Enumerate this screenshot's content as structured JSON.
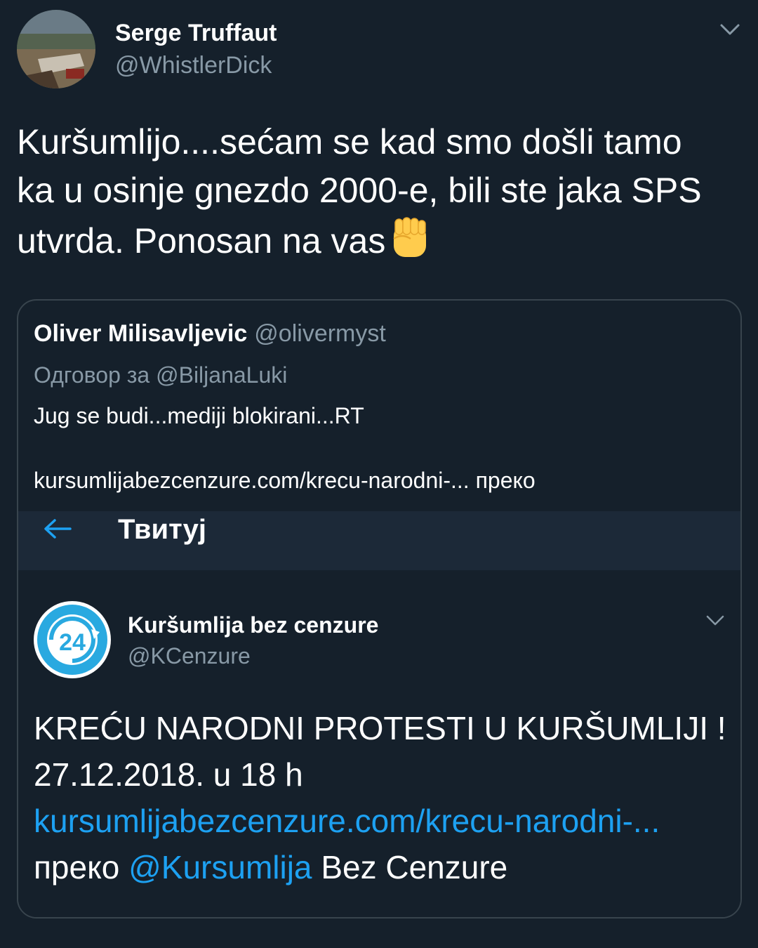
{
  "tweet": {
    "author": {
      "display_name": "Serge Truffaut",
      "handle": "@WhistlerDick"
    },
    "text_lines": [
      "Kuršumlijo....sećam se kad smo došli tamo",
      "ka u osinje gnezdo 2000-e, bili ste jaka SPS",
      "utvrda. Ponosan na vas"
    ],
    "emoji": "raised-fist"
  },
  "quoted": {
    "author": {
      "display_name": "Oliver Milisavljevic",
      "handle": "@olivermyst"
    },
    "reply_to": "Одговор за @BiljanaLuki",
    "body_line1": "Jug se budi...mediji blokirani...RT",
    "body_line2": "kursumlijabezcenzure.com/krecu-narodni-... преко"
  },
  "screenshot": {
    "header_title": "Твитуј",
    "author": {
      "display_name": "Kuršumlija bez cenzure",
      "handle": "@KCenzure"
    },
    "avatar_badge": "24",
    "line1": "KREĆU NARODNI PROTESTI U KURŠUMLIJI !",
    "line2": "27.12.2018. u 18 h",
    "link": "kursumlijabezcenzure.com/krecu-narodni-...",
    "via_prefix": "преко",
    "mention": "@Kursumlija",
    "via_suffix": "Bez Cenzure"
  },
  "colors": {
    "background": "#15202b",
    "secondary_text": "#8899a6",
    "link": "#1da1f2",
    "border": "#38444d",
    "screenshot_header": "#1c2938"
  }
}
